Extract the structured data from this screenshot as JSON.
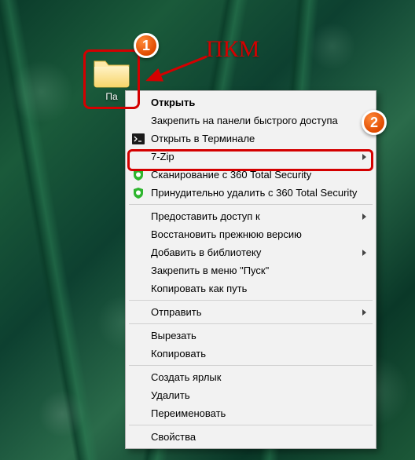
{
  "annotations": {
    "pkm_label": "ПКМ",
    "badge1": "1",
    "badge2": "2"
  },
  "folder": {
    "label": "Па"
  },
  "context_menu": {
    "open": "Открыть",
    "pin_quick_access": "Закрепить на панели быстрого доступа",
    "open_terminal": "Открыть в Терминале",
    "seven_zip": "7-Zip",
    "scan_360": "Сканирование с 360 Total Security",
    "force_delete_360": "Принудительно удалить с  360 Total Security",
    "share_access": "Предоставить доступ к",
    "restore_prev": "Восстановить прежнюю версию",
    "add_library": "Добавить в библиотеку",
    "pin_start": "Закрепить в меню \"Пуск\"",
    "copy_as_path": "Копировать как путь",
    "send_to": "Отправить",
    "cut": "Вырезать",
    "copy": "Копировать",
    "create_shortcut": "Создать ярлык",
    "delete": "Удалить",
    "rename": "Переименовать",
    "properties": "Свойства"
  }
}
